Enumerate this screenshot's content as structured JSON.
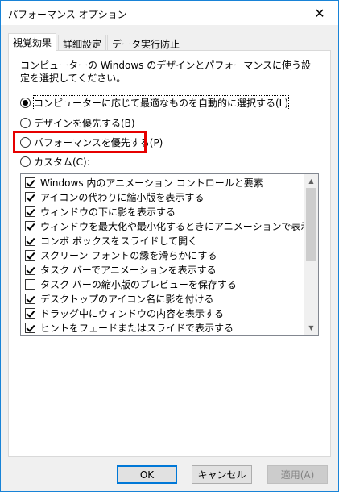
{
  "window": {
    "title": "パフォーマンス オプション",
    "close_glyph": "✕"
  },
  "tabs": [
    {
      "label": "視覚効果",
      "active": true
    },
    {
      "label": "詳細設定",
      "active": false
    },
    {
      "label": "データ実行防止",
      "active": false
    }
  ],
  "description": "コンピューターの Windows のデザインとパフォーマンスに使う設定を選択してください。",
  "radios": [
    {
      "label": "コンピューターに応じて最適なものを自動的に選択する(L)",
      "checked": true
    },
    {
      "label": "デザインを優先する(B)",
      "checked": false
    },
    {
      "label": "パフォーマンスを優先する(P)",
      "checked": false
    },
    {
      "label": "カスタム(C):",
      "checked": false
    }
  ],
  "effects": [
    {
      "label": "Windows 内のアニメーション コントロールと要素",
      "checked": true
    },
    {
      "label": "アイコンの代わりに縮小版を表示する",
      "checked": true
    },
    {
      "label": "ウィンドウの下に影を表示する",
      "checked": true
    },
    {
      "label": "ウィンドウを最大化や最小化するときにアニメーションで表示する",
      "checked": true
    },
    {
      "label": "コンボ ボックスをスライドして開く",
      "checked": true
    },
    {
      "label": "スクリーン フォントの縁を滑らかにする",
      "checked": true
    },
    {
      "label": "タスク バーでアニメーションを表示する",
      "checked": true
    },
    {
      "label": "タスク バーの縮小版のプレビューを保存する",
      "checked": false
    },
    {
      "label": "デスクトップのアイコン名に影を付ける",
      "checked": true
    },
    {
      "label": "ドラッグ中にウィンドウの内容を表示する",
      "checked": true
    },
    {
      "label": "ヒントをフェードまたはスライドで表示する",
      "checked": true
    }
  ],
  "buttons": {
    "ok": "OK",
    "cancel": "キャンセル",
    "apply": "適用(A)"
  },
  "colors": {
    "highlight": "#e60000",
    "accent": "#0078d7"
  }
}
